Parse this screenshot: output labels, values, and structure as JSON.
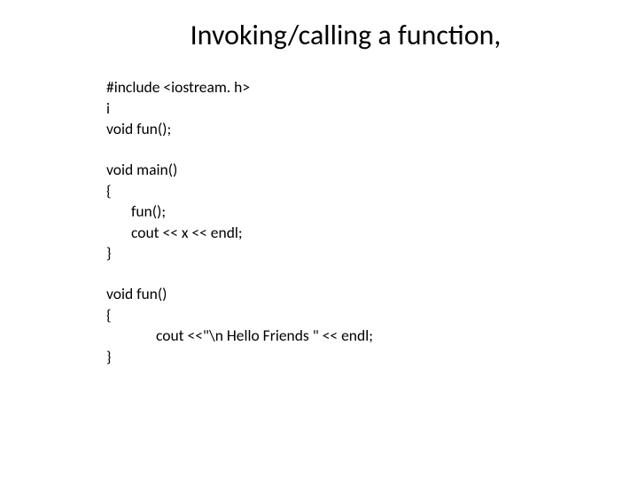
{
  "title": "Invoking/calling a function,",
  "code": {
    "l1": "#include <iostream. h>",
    "l2": "i",
    "l3": "void fun();",
    "l4": "void main()",
    "l5": "{",
    "l6": "fun();",
    "l7": "cout << x << endl;",
    "l8": "}",
    "l9": "void fun()",
    "l10": "{",
    "l11": "cout <<\"\\n Hello Friends \" << endl;",
    "l12": "}"
  }
}
